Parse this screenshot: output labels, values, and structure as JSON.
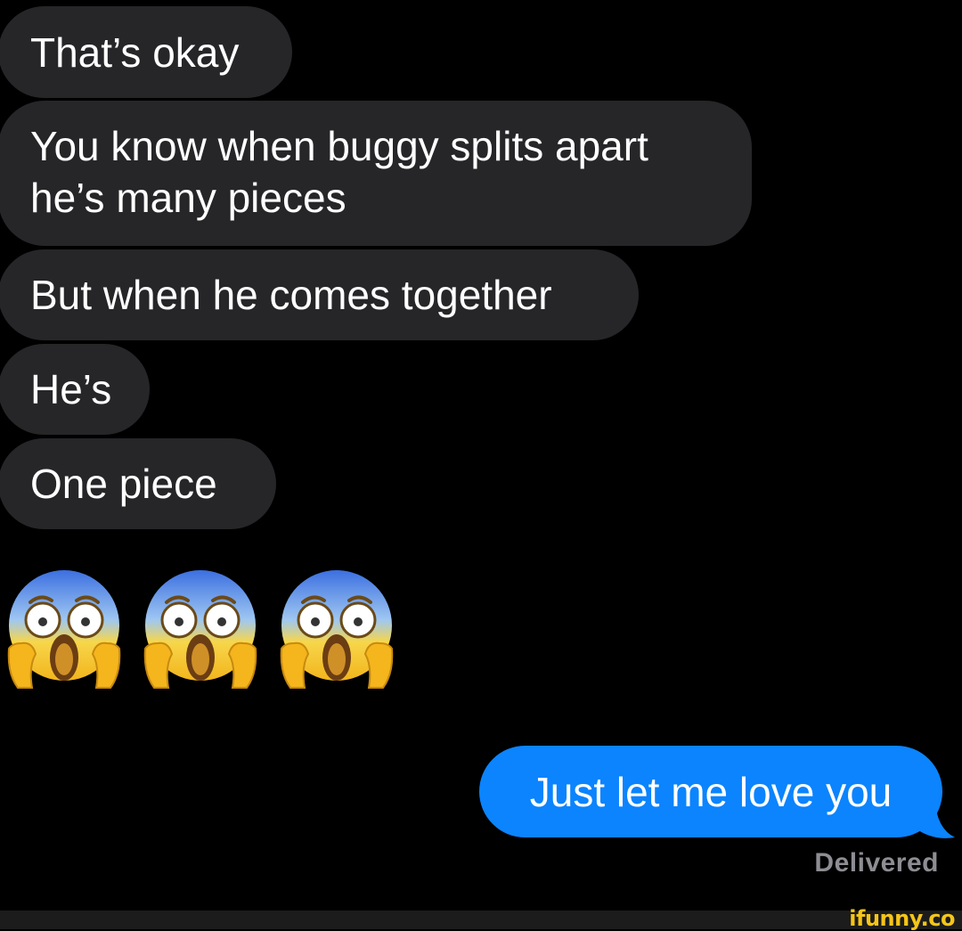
{
  "conversation": {
    "incoming_messages": [
      {
        "text": "That’s okay"
      },
      {
        "line1": "You know when buggy splits apart",
        "line2": "he’s many pieces"
      },
      {
        "text": "But when he comes together"
      },
      {
        "text": "He’s"
      },
      {
        "text": "One piece"
      }
    ],
    "emoji_message": {
      "emoji": [
        "face-screaming-in-fear",
        "face-screaming-in-fear",
        "face-screaming-in-fear"
      ]
    },
    "outgoing_messages": [
      {
        "text": "Just let me love you"
      }
    ],
    "delivery_status": "Delivered"
  },
  "colors": {
    "background": "#000000",
    "incoming_bubble": "#262629",
    "outgoing_bubble": "#0b84fe",
    "status_text": "#8d8d93"
  },
  "watermark": "ifunny.co"
}
